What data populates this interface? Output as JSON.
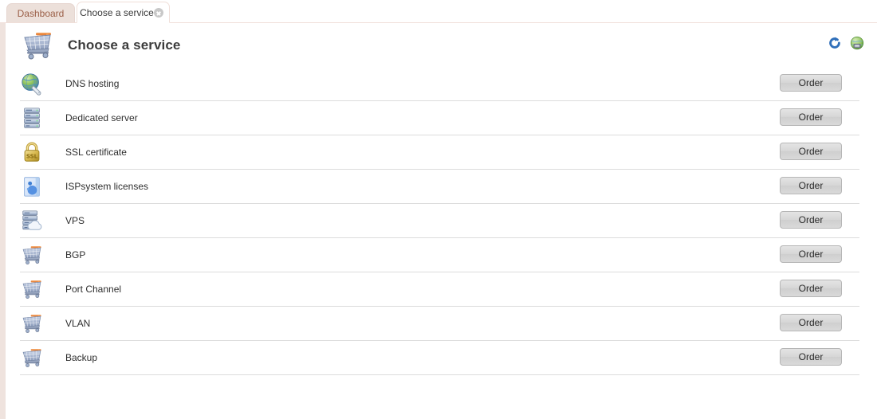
{
  "tabs": [
    {
      "label": "Dashboard",
      "active": false,
      "closable": false
    },
    {
      "label": "Choose a service",
      "active": true,
      "closable": true
    }
  ],
  "header": {
    "title": "Choose a service",
    "icon": "shopping-cart-icon",
    "actions": [
      {
        "name": "refresh-icon",
        "label": "Refresh",
        "color": "#2f6fba"
      },
      {
        "name": "globe-icon",
        "label": "Region",
        "color": "#7fb04a"
      }
    ]
  },
  "colors": {
    "tab_bar_border": "#f0dfd9",
    "tab_inactive_bg": "#ece0da",
    "tab_inactive_text": "#9b5f47",
    "panel_left_border": "#efe3de",
    "row_separator": "#dcdcdc",
    "title_text": "#3c3c3c",
    "button_text": "#2b2b2b"
  },
  "order_label": "Order",
  "services": [
    {
      "name": "DNS hosting",
      "icon": "dns-globe-icon",
      "order_label": "Order"
    },
    {
      "name": "Dedicated server",
      "icon": "server-rack-icon",
      "order_label": "Order"
    },
    {
      "name": "SSL certificate",
      "icon": "ssl-lock-icon",
      "order_label": "Order"
    },
    {
      "name": "ISPsystem licenses",
      "icon": "license-card-icon",
      "order_label": "Order"
    },
    {
      "name": "VPS",
      "icon": "vps-cloud-icon",
      "order_label": "Order"
    },
    {
      "name": "BGP",
      "icon": "shopping-cart-icon",
      "order_label": "Order"
    },
    {
      "name": "Port Channel",
      "icon": "shopping-cart-icon",
      "order_label": "Order"
    },
    {
      "name": "VLAN",
      "icon": "shopping-cart-icon",
      "order_label": "Order"
    },
    {
      "name": "Backup",
      "icon": "shopping-cart-icon",
      "order_label": "Order"
    }
  ]
}
